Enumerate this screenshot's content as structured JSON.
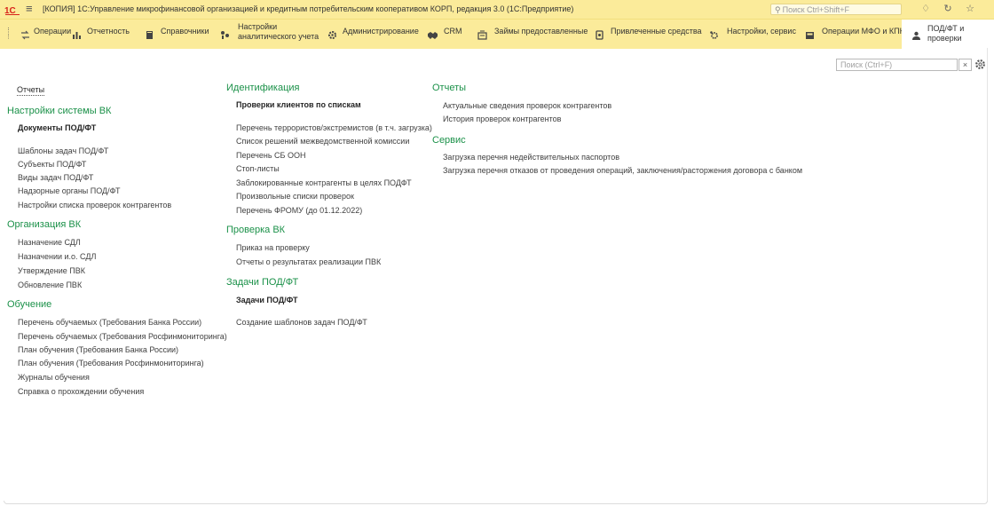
{
  "window": {
    "title": "[КОПИЯ] 1С:Управление микрофинансовой организацией и кредитным потребительским кооперативом КОРП, редакция 3.0  (1С:Предприятие)",
    "search_placeholder": "Поиск Ctrl+Shift+F",
    "icons": [
      "menu-icon",
      "bell-icon",
      "history-icon",
      "favorites-star-icon"
    ]
  },
  "sections": [
    {
      "label": "Операции",
      "icon": "operations-icon"
    },
    {
      "label": "Отчетность",
      "icon": "bar-chart-icon"
    },
    {
      "label": "Справочники",
      "icon": "book-icon"
    },
    {
      "label": "Настройки аналитического учета",
      "icon": "analytics-settings-icon"
    },
    {
      "label": "Администрирование",
      "icon": "gear-icon"
    },
    {
      "label": "CRM",
      "icon": "handshake-icon"
    },
    {
      "label": "Займы предоставленные",
      "icon": "loans-icon"
    },
    {
      "label": "Привлеченные средства",
      "icon": "funds-icon"
    },
    {
      "label": "Настройки, сервис",
      "icon": "service-settings-icon"
    },
    {
      "label": "Операции МФО и КПК",
      "icon": "register-icon"
    },
    {
      "label": "ПОД/ФТ и проверки",
      "icon": "inspection-icon"
    }
  ],
  "active_section": "ПОД/ФТ и проверки",
  "content_search": {
    "placeholder": "Поиск (Ctrl+F)",
    "clear_label": "×"
  },
  "nav": {
    "reports_link": "Отчеты",
    "col1": {
      "nastroiki": {
        "title": "Настройки системы ВК",
        "items": [
          "Документы ПОД/ФТ",
          "Шаблоны задач ПОД/ФТ",
          "Субъекты ПОД/ФТ",
          "Виды задач ПОД/ФТ",
          "Надзорные органы ПОД/ФТ",
          "Настройки списка проверок контрагентов"
        ]
      },
      "organizatsiya": {
        "title": "Организация ВК",
        "items": [
          "Назначение СДЛ",
          "Назначении и.о. СДЛ",
          "Утверждение ПВК",
          "Обновление ПВК"
        ]
      },
      "obuchenie": {
        "title": "Обучение",
        "items": [
          "Перечень обучаемых (Требования Банка России)",
          "Перечень обучаемых (Требования Росфинмониторинга)",
          "План обучения (Требования Банка России)",
          "План обучения (Требования Росфинмониторинга)",
          "Журналы обучения",
          "Справка о прохождении обучения"
        ]
      }
    },
    "col2": {
      "identifikatsiya": {
        "title": "Идентификация",
        "items": [
          "Проверки клиентов по спискам",
          "Перечень террористов/экстремистов (в т.ч. загрузка)",
          "Список решений межведомственной комиссии",
          "Перечень СБ ООН",
          "Стоп-листы",
          "Заблокированные контрагенты в целях ПОДФТ",
          "Произвольные списки проверок",
          "Перечень ФРОМУ (до 01.12.2022)"
        ]
      },
      "proverka": {
        "title": "Проверка ВК",
        "items": [
          "Приказ на проверку",
          "Отчеты о результатах реализации ПВК"
        ]
      },
      "zadachi": {
        "title": "Задачи ПОД/ФТ",
        "items": [
          "Задачи ПОД/ФТ",
          "Создание шаблонов задач ПОД/ФТ"
        ]
      }
    },
    "col3": {
      "otchety": {
        "title": "Отчеты",
        "items": [
          "Актуальные сведения проверок контрагентов",
          "История проверок контрагентов"
        ]
      },
      "servis": {
        "title": "Сервис",
        "items": [
          "Загрузка перечня недействительных паспортов",
          "Загрузка перечня отказов от проведения операций, заключения/расторжения договора с банком"
        ]
      }
    }
  },
  "colors": {
    "panel_bg": "#fbeb9a",
    "group_title": "#1b9149",
    "text": "#404040",
    "logo_red": "#d7241b"
  }
}
